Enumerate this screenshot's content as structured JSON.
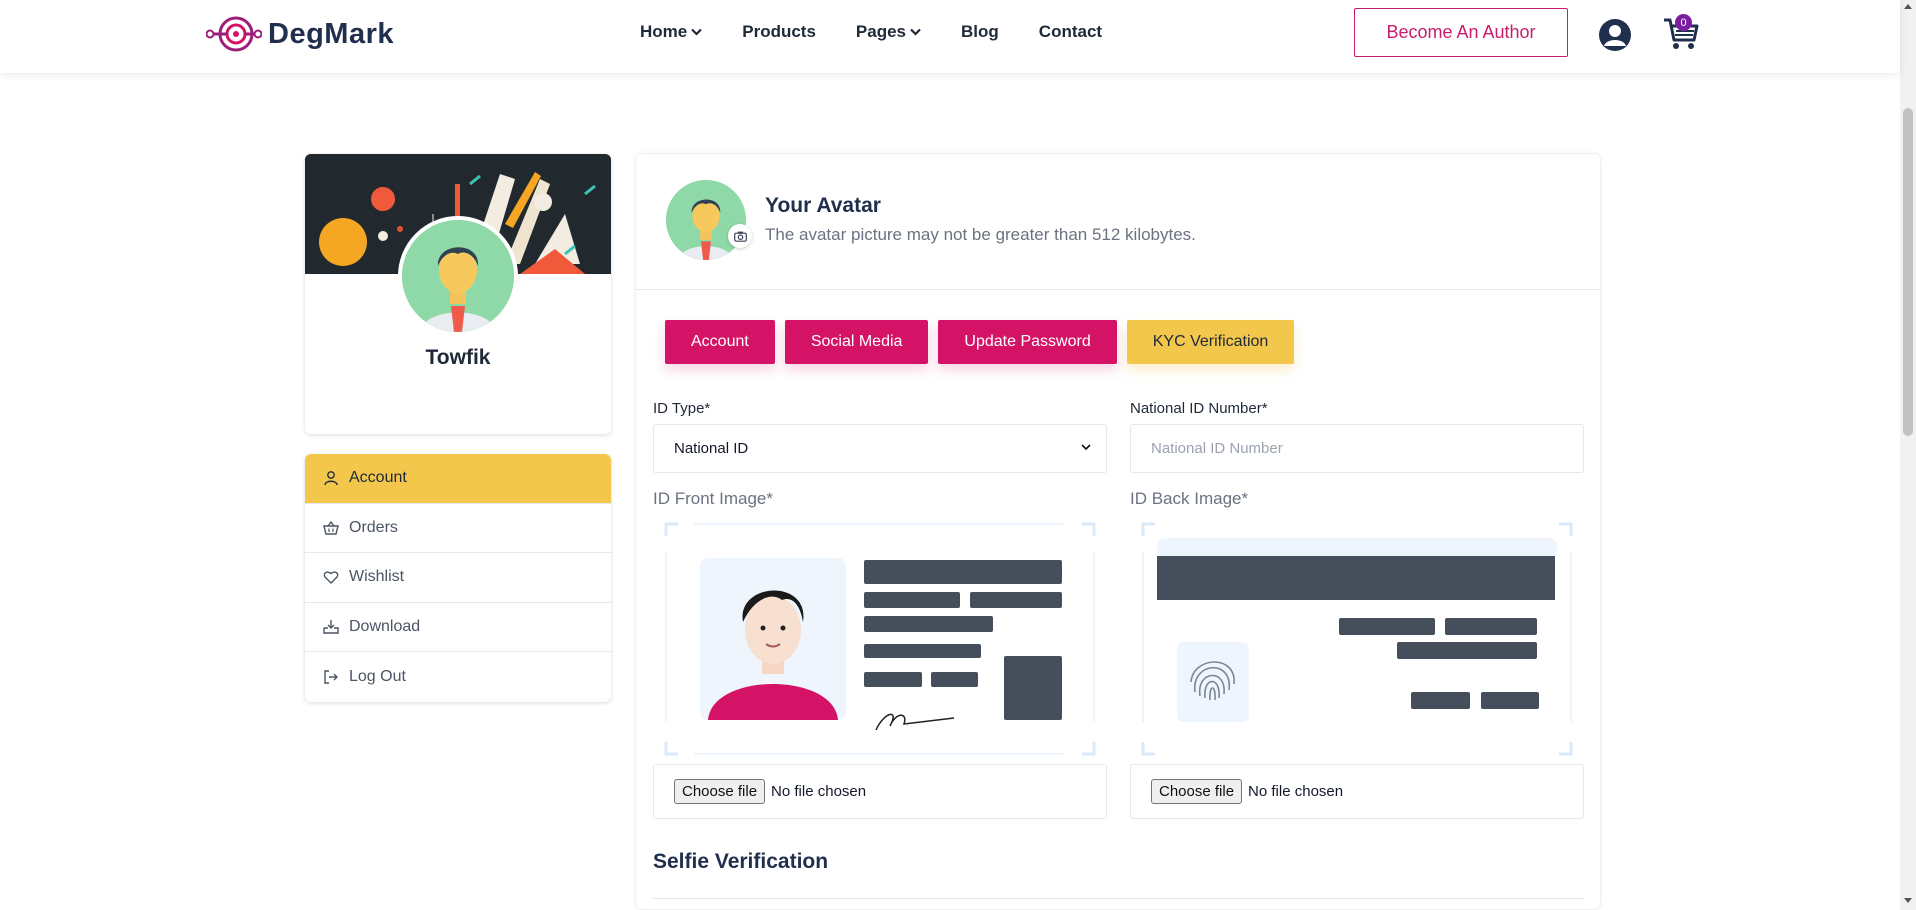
{
  "brand": {
    "name": "DegMark"
  },
  "nav": {
    "items": [
      {
        "label": "Home",
        "dropdown": true
      },
      {
        "label": "Products",
        "dropdown": false
      },
      {
        "label": "Pages",
        "dropdown": true
      },
      {
        "label": "Blog",
        "dropdown": false
      },
      {
        "label": "Contact",
        "dropdown": false
      }
    ],
    "author_button": "Become An Author",
    "cart_count": "0"
  },
  "profile": {
    "name": "Towfik"
  },
  "sidebar": {
    "items": [
      {
        "label": "Account",
        "icon": "user-icon",
        "active": true
      },
      {
        "label": "Orders",
        "icon": "basket-icon",
        "active": false
      },
      {
        "label": "Wishlist",
        "icon": "heart-icon",
        "active": false
      },
      {
        "label": "Download",
        "icon": "download-icon",
        "active": false
      },
      {
        "label": "Log Out",
        "icon": "logout-icon",
        "active": false
      }
    ]
  },
  "avatar_section": {
    "title": "Your Avatar",
    "description": "The avatar picture may not be greater than 512 kilobytes."
  },
  "tabs": [
    {
      "label": "Account",
      "active": false
    },
    {
      "label": "Social Media",
      "active": false
    },
    {
      "label": "Update Password",
      "active": false
    },
    {
      "label": "KYC Verification",
      "active": true
    }
  ],
  "form": {
    "id_type_label": "ID Type*",
    "id_type_value": "National ID",
    "nid_label": "National ID Number*",
    "nid_placeholder": "National ID Number",
    "front_label": "ID Front Image*",
    "back_label": "ID Back Image*",
    "choose_file": "Choose file",
    "no_file": "No file chosen",
    "selfie_title": "Selfie Verification"
  },
  "colors": {
    "primary": "#d41367",
    "accent": "#f3c74b",
    "navy": "#1f2f4d",
    "badge": "#7b1fa2"
  }
}
